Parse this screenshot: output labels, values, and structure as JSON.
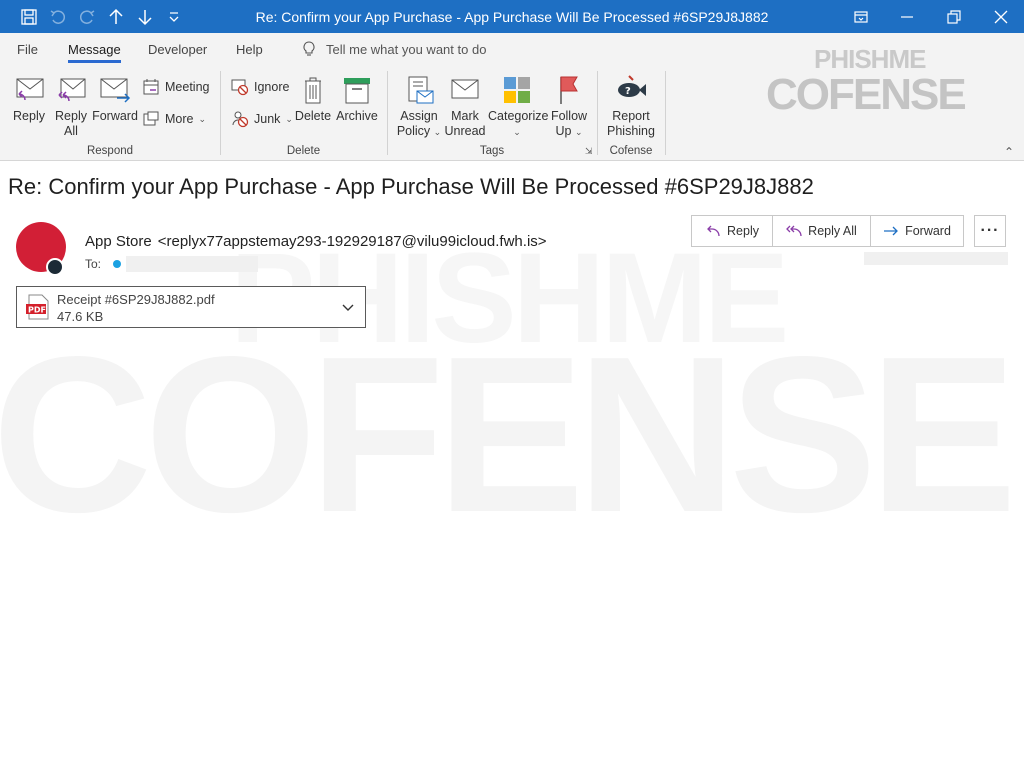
{
  "window": {
    "title": "Re: Confirm your App Purchase - App Purchase Will Be Processed #6SP29J8J882"
  },
  "tabs": [
    {
      "label": "File"
    },
    {
      "label": "Message"
    },
    {
      "label": "Developer"
    },
    {
      "label": "Help"
    }
  ],
  "tell_me": "Tell me what you want to do",
  "ribbon": {
    "respond": {
      "label": "Respond",
      "reply": "Reply",
      "reply_all_1": "Reply",
      "reply_all_2": "All",
      "forward": "Forward",
      "meeting": "Meeting",
      "more": "More"
    },
    "delete": {
      "label": "Delete",
      "ignore": "Ignore",
      "junk": "Junk",
      "delete": "Delete",
      "archive": "Archive"
    },
    "tags": {
      "label": "Tags",
      "assign_1": "Assign",
      "assign_2": "Policy",
      "mark_1": "Mark",
      "mark_2": "Unread",
      "categorize": "Categorize",
      "follow_1": "Follow",
      "follow_2": "Up"
    },
    "cofense": {
      "label": "Cofense",
      "report_1": "Report",
      "report_2": "Phishing"
    }
  },
  "logo": {
    "top": "PHISHME",
    "bottom": "COFENSE"
  },
  "message": {
    "subject": "Re: Confirm your App Purchase - App Purchase Will Be Processed #6SP29J8J882",
    "sender_name": "App Store",
    "sender_address": "<replyx77appstemay293-192929187@vilu99icloud.fwh.is>",
    "to_label": "To:",
    "actions": {
      "reply": "Reply",
      "reply_all": "Reply All",
      "forward": "Forward",
      "more": "···"
    },
    "attachment": {
      "name": "Receipt #6SP29J8J882.pdf",
      "size": "47.6 KB",
      "type_badge": "PDF"
    }
  },
  "colors": {
    "title_bar": "#1e6fc3",
    "avatar": "#d21f36",
    "accent": "#2b6ad1"
  }
}
